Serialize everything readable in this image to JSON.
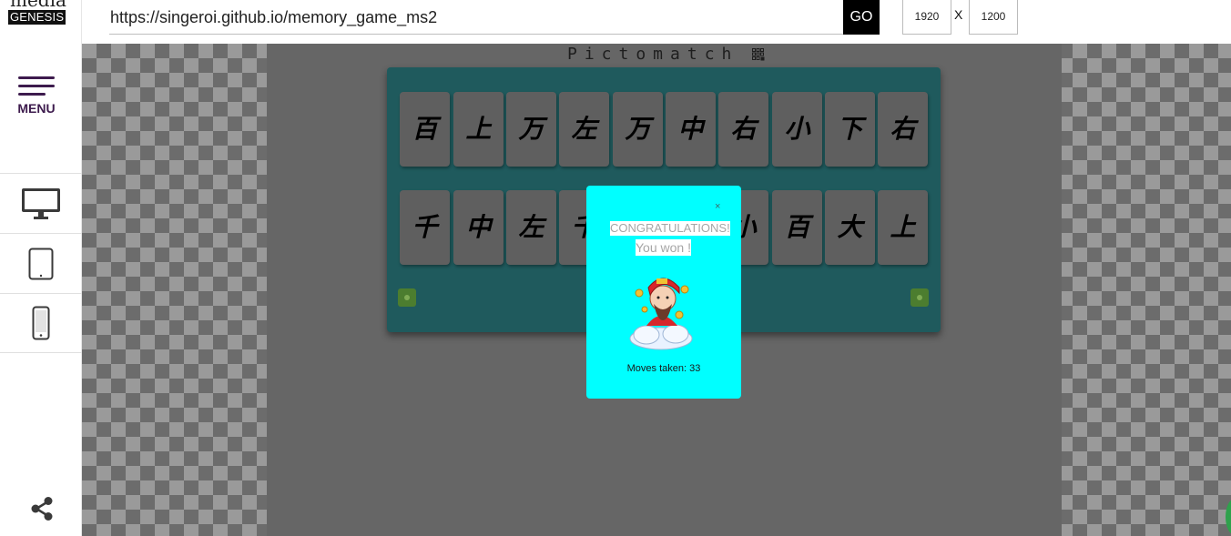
{
  "sidebar": {
    "logo_top": "media",
    "logo_bottom": "GENESIS",
    "menu_label": "MENU",
    "devices": [
      "desktop-icon",
      "tablet-icon",
      "phone-icon"
    ],
    "share": "share-icon"
  },
  "toolbar": {
    "url": "https://singeroi.github.io/memory_game_ms2",
    "go_label": "GO",
    "width": "1920",
    "sep": "X",
    "height": "1200"
  },
  "game": {
    "title": "Pictomatch",
    "row1": [
      "百",
      "上",
      "万",
      "左",
      "万",
      "中",
      "右",
      "小",
      "下",
      "右"
    ],
    "row2": [
      "千",
      "中",
      "左",
      "千",
      "",
      "",
      "小",
      "百",
      "大",
      "上"
    ]
  },
  "modal": {
    "close": "×",
    "congrats": "CONGRATULATIONS!",
    "won": "You won !",
    "moves": "Moves taken: 33"
  },
  "colors": {
    "board": "#1f5a5d",
    "modal": "#00ffff",
    "accent": "#3d1b4d"
  }
}
